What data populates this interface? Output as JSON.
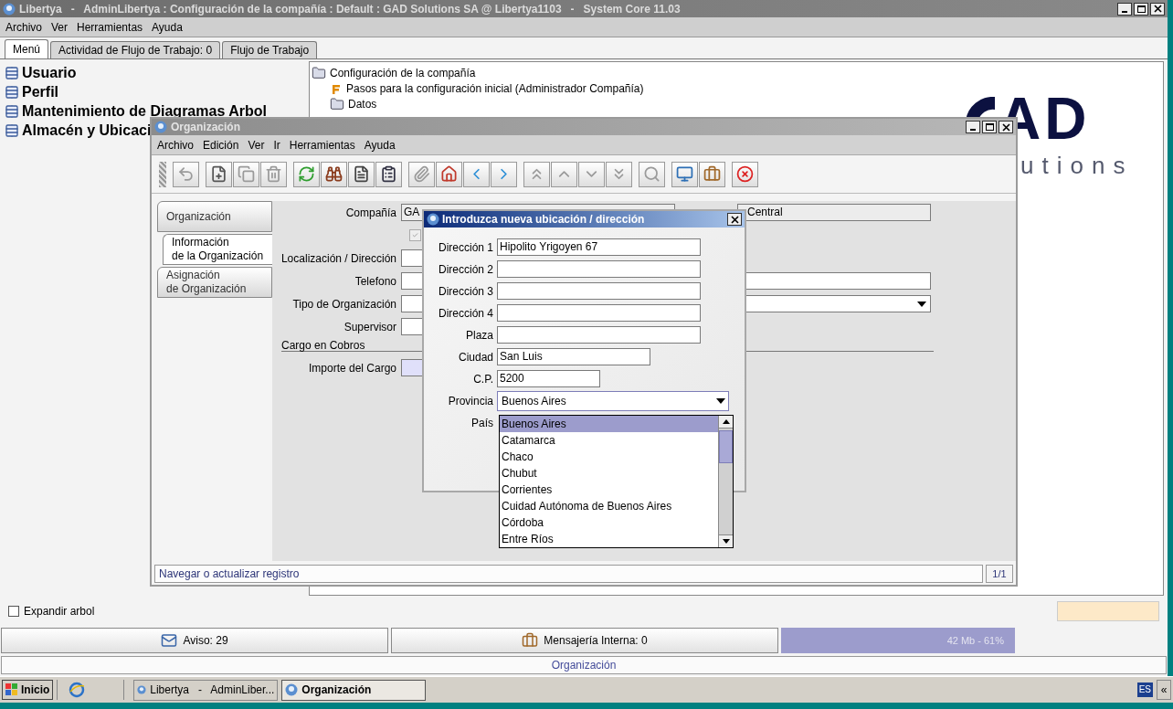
{
  "window": {
    "title": "Libertya   -   AdminLibertya : Configuración de la compañía : Default : GAD Solutions SA @ Libertya1103   -   System Core 11.03"
  },
  "menu": [
    "Archivo",
    "Ver",
    "Herramientas",
    "Ayuda"
  ],
  "tabs": [
    {
      "label": "Menú",
      "selected": true
    },
    {
      "label": "Actividad de Flujo de Trabajo: 0",
      "selected": false
    },
    {
      "label": "Flujo de Trabajo",
      "selected": false
    }
  ],
  "favorites": [
    "Usuario",
    "Perfil",
    "Mantenimiento de Diagramas Arbol",
    "Almacén y Ubicaci"
  ],
  "tree": [
    {
      "label": "Configuración de la compañía",
      "kind": "folder",
      "children": [
        {
          "label": "Pasos para la configuración inicial (Administrador Compañía)",
          "kind": "workflow"
        },
        {
          "label": "Datos",
          "kind": "folder"
        }
      ]
    }
  ],
  "logo": {
    "mark": "AD",
    "text": "utions"
  },
  "org_window": {
    "title": "Organización",
    "menu": [
      "Archivo",
      "Edición",
      "Ver",
      "Ir",
      "Herramientas",
      "Ayuda"
    ],
    "toolbar": [
      [
        {
          "kind": "undo",
          "disabled": true
        }
      ],
      [
        {
          "kind": "new",
          "disabled": false
        },
        {
          "kind": "copy",
          "disabled": true
        },
        {
          "kind": "delete",
          "disabled": true
        }
      ],
      [
        {
          "kind": "refresh",
          "disabled": false
        },
        {
          "kind": "find",
          "disabled": false
        },
        {
          "kind": "list",
          "disabled": false
        },
        {
          "kind": "form",
          "disabled": false
        }
      ],
      [
        {
          "kind": "attach",
          "disabled": true
        },
        {
          "kind": "home",
          "disabled": false
        },
        {
          "kind": "back",
          "disabled": false
        },
        {
          "kind": "forward",
          "disabled": false
        }
      ],
      [
        {
          "kind": "first",
          "disabled": true
        },
        {
          "kind": "previous",
          "disabled": true
        },
        {
          "kind": "next",
          "disabled": true
        },
        {
          "kind": "last",
          "disabled": true
        }
      ],
      [
        {
          "kind": "zoom",
          "disabled": true
        }
      ],
      [
        {
          "kind": "export",
          "disabled": false
        },
        {
          "kind": "archive",
          "disabled": false
        }
      ],
      [
        {
          "kind": "exit",
          "disabled": false
        }
      ]
    ],
    "side_tabs": [
      {
        "label": "Organización",
        "selected": false
      },
      {
        "label": "Información\nde la Organización",
        "selected": true
      },
      {
        "label": "Asignación\nde Organización",
        "selected": false
      }
    ],
    "company": {
      "label": "Compañía",
      "value": "GA",
      "value_2": "Central"
    },
    "active_checkbox": {
      "checked": true,
      "disabled": true
    },
    "location_label": "Localización / Dirección",
    "phone_label": "Telefono",
    "org_type_label": "Tipo de Organización",
    "supervisor_label": "Supervisor",
    "section": "Cargo en Cobros",
    "charge_label": "Importe del Cargo",
    "status": "Navegar o actualizar registro",
    "record": "1/1"
  },
  "dialog": {
    "title": "Introduzca nueva ubicación / dirección",
    "fields": [
      {
        "label": "Dirección 1",
        "value": "Hipolito Yrigoyen 67",
        "kind": "long"
      },
      {
        "label": "Dirección 2",
        "kind": "long"
      },
      {
        "label": "Dirección 3",
        "kind": "long"
      },
      {
        "label": "Dirección 4",
        "kind": "long"
      },
      {
        "label": "Plaza",
        "kind": "long"
      },
      {
        "label": "Ciudad",
        "value": "San Luis",
        "kind": "medium"
      },
      {
        "label": "C.P.",
        "value": "5200",
        "kind": "short"
      },
      {
        "label": "Provincia",
        "value": "Buenos Aires",
        "kind": "combo"
      },
      {
        "label": "País",
        "kind": "hidden"
      }
    ],
    "options": [
      {
        "label": "Buenos Aires",
        "selected": true
      },
      {
        "label": "Catamarca",
        "selected": false
      },
      {
        "label": "Chaco",
        "selected": false
      },
      {
        "label": "Chubut",
        "selected": false
      },
      {
        "label": "Corrientes",
        "selected": false
      },
      {
        "label": "Cuidad Autónoma de Buenos Aires",
        "selected": false
      },
      {
        "label": "Córdoba",
        "selected": false
      },
      {
        "label": "Entre Ríos",
        "selected": false
      }
    ]
  },
  "expand_tree": {
    "label": "Expandir arbol",
    "checked": false
  },
  "status_row": {
    "notices": "Aviso: 29",
    "messages": "Mensajería Interna: 0",
    "memory": "42 Mb - 61%"
  },
  "active_window": "Organización",
  "taskbar": {
    "start": "Inicio",
    "tasks": [
      {
        "label": "Libertya   -   AdminLiber...",
        "selected": false
      },
      {
        "label": "Organización",
        "selected": true
      }
    ],
    "language": "ES",
    "collapse": "«"
  }
}
